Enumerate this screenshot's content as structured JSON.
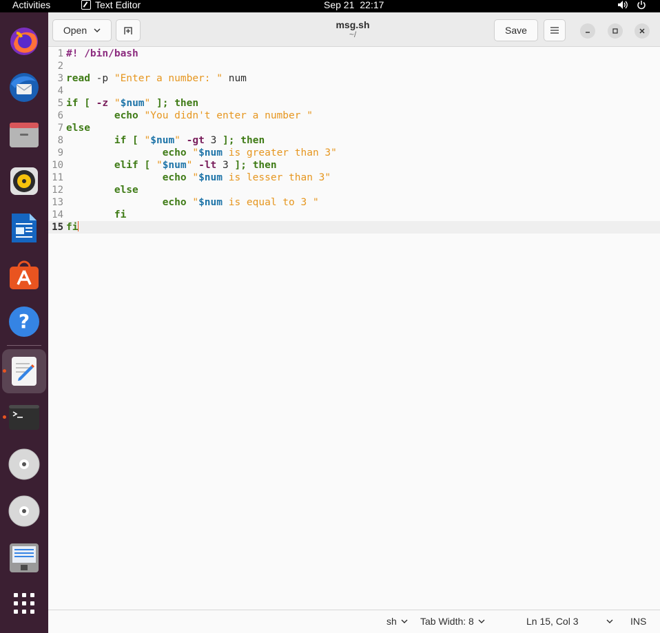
{
  "topbar": {
    "activities": "Activities",
    "app_name": "Text Editor",
    "date": "Sep 21",
    "time": "22:17"
  },
  "dock": {
    "items": [
      "firefox",
      "thunderbird",
      "files",
      "rhythmbox",
      "libreoffice-writer",
      "ubuntu-software",
      "help",
      "text-editor",
      "terminal",
      "cd-drive",
      "cd-drive",
      "disk",
      "show-applications"
    ]
  },
  "header": {
    "open_label": "Open",
    "save_label": "Save",
    "file_name": "msg.sh",
    "file_path": "~/"
  },
  "editor": {
    "lines": [
      "#! /bin/bash",
      "",
      "read -p \"Enter a number: \" num",
      "",
      "if [ -z \"$num\" ]; then",
      "        echo \"You didn't enter a number \"",
      "else",
      "        if [ \"$num\" -gt 3 ]; then",
      "                echo \"$num is greater than 3\"",
      "        elif [ \"$num\" -lt 3 ]; then",
      "                echo \"$num is lesser than 3\"",
      "        else",
      "                echo \"$num is equal to 3 \"",
      "        fi",
      "fi"
    ],
    "current_line": 15
  },
  "statusbar": {
    "language": "sh",
    "tab_width": "Tab Width: 8",
    "position": "Ln 15, Col 3",
    "mode": "INS"
  },
  "colors": {
    "accent": "#e95420",
    "dock_bg": "#3b1f32",
    "keyword": "#3f7b16",
    "string": "#e6961f",
    "variable": "#1e74a8"
  }
}
